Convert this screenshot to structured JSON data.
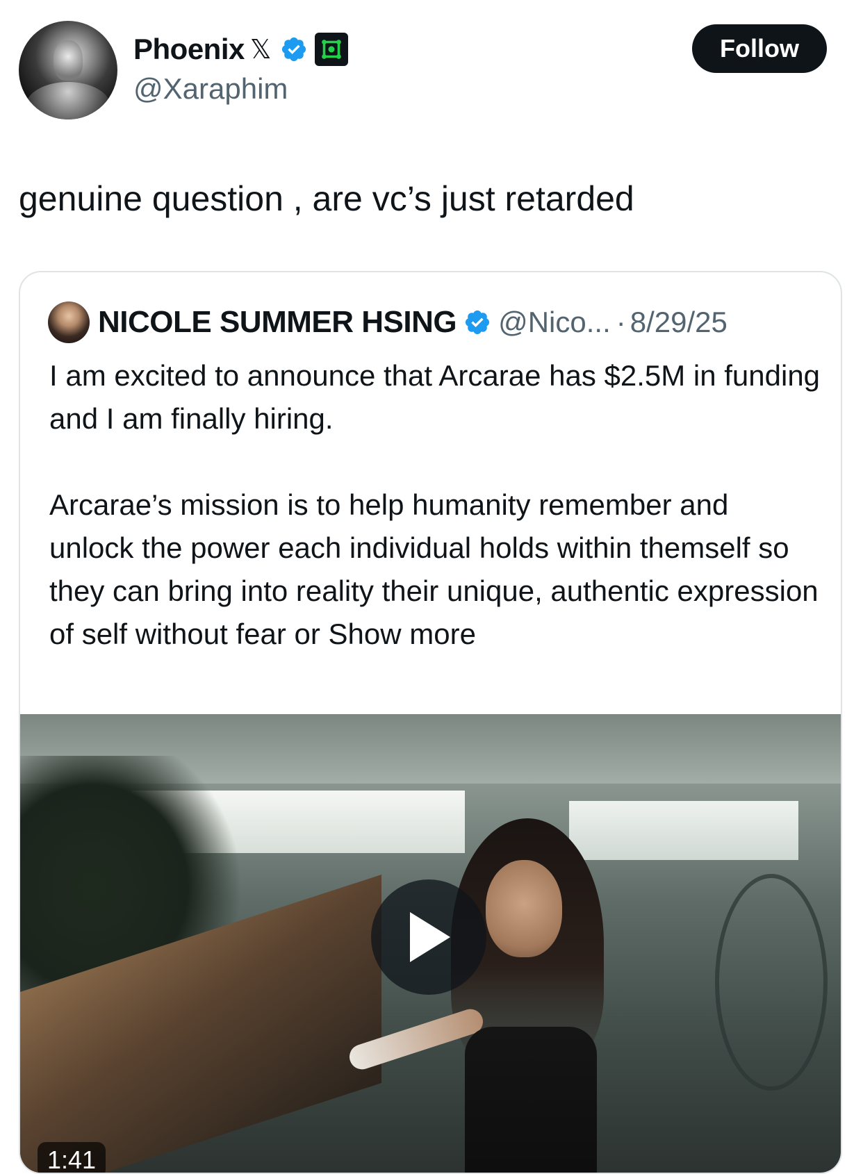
{
  "author": {
    "display_name": "Phoenix",
    "name_glyph": "𝕏",
    "handle": "@Xaraphim",
    "verified": true,
    "affiliate_badge_icon": "green-affiliate-icon"
  },
  "follow_button": {
    "label": "Follow"
  },
  "tweet": {
    "text": "genuine question , are vc’s just retarded"
  },
  "quoted_tweet": {
    "display_name": "NICOLE SUMMER HSING",
    "verified": true,
    "handle": "@Nico...",
    "separator": "·",
    "date": "8/29/25",
    "paragraphs": [
      "I am excited to announce that Arcarae has $2.5M in funding and I am finally hiring.",
      "Arcarae’s mission is to help humanity remember and unlock the power each individual holds within themself so they can bring into reality their unique, authentic expression of self without fear or"
    ],
    "show_more_label": "Show more",
    "media": {
      "type": "video",
      "duration": "1:41",
      "play_icon": "play-icon"
    }
  },
  "colors": {
    "text_primary": "#0f1419",
    "text_secondary": "#536471",
    "verified_blue": "#1d9bf0",
    "affiliate_green": "#22d34a",
    "border": "#dfe3e6"
  }
}
